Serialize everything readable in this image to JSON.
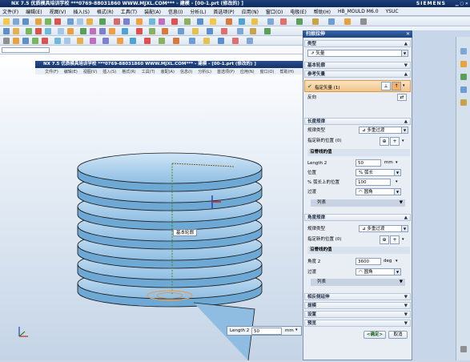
{
  "app": {
    "title": "NX 7.5 优质模具培训学校  ***0769-88031860  WWW.MJXL.COM***  - 建模 - [00-1.prt (修改的) ]",
    "brand": "SIEMENS",
    "inner_title": "NX 7.5 优质模具培训学校  ***0769-88031860  WWW.MJXL.COM***  - 建模 - [00-1.prt (修改的) ]"
  },
  "menu": [
    "文件(F)",
    "编辑(E)",
    "视图(V)",
    "插入(S)",
    "格式(R)",
    "工具(T)",
    "装配(A)",
    "信息(I)",
    "分析(L)",
    "首选项(P)",
    "应用(N)",
    "窗口(O)",
    "电极(E)",
    "帮助(H)",
    "HB_MOULD M6.0",
    "YSUC"
  ],
  "inner_menu": [
    "文件(F)",
    "编辑(E)",
    "视图(V)",
    "插入(S)",
    "格式(R)",
    "工具(T)",
    "装配(A)",
    "信息(I)",
    "分析(L)",
    "首选项(P)",
    "应用(N)",
    "窗口(O)",
    "帮助(H)"
  ],
  "viewport": {
    "annotation": "基本轮廓",
    "length_popup": {
      "label": "Length 2",
      "value": "50",
      "unit": "mm"
    }
  },
  "dialog": {
    "title": "扫掠拉伸",
    "type": {
      "header": "类型",
      "value": "矢量"
    },
    "base_contour": {
      "header": "基本轮廓"
    },
    "ref_vector": {
      "header": "参考矢量",
      "specify_label": "指定矢量 (1)",
      "reverse_label": "反向"
    },
    "length_law": {
      "header": "长度规律",
      "law_type_label": "规律类型",
      "law_type_value": "多重过渡",
      "specify_point_label": "指定新的位置 (0)",
      "points_header": "沿脊线的值",
      "length_label": "Length 2",
      "length_value": "50",
      "length_unit": "mm",
      "position_label": "位置",
      "position_value": "% 弧长",
      "percent_label": "% 弧长上的位置",
      "percent_value": "100",
      "transition_label": "过渡",
      "transition_value": "圆角",
      "list_label": "列表"
    },
    "angle_law": {
      "header": "角度规律",
      "law_type_label": "规律类型",
      "law_type_value": "多重过渡",
      "specify_point_label": "指定新的位置 (0)",
      "points_header": "沿脊线的值",
      "angle_label": "角度 2",
      "angle_value": "3600",
      "angle_unit": "deg",
      "transition_label": "过渡",
      "transition_value": "圆角",
      "list_label": "列表"
    },
    "collapsed_sections": [
      "相反侧延伸",
      "拔模",
      "设置",
      "预览"
    ],
    "ok_label": "<确定>",
    "cancel_label": "取消"
  },
  "colors": {
    "accent": "#1d4482",
    "body": "#a6cdea",
    "edge": "#1a1a1a",
    "highlight": "#f2c48a"
  }
}
